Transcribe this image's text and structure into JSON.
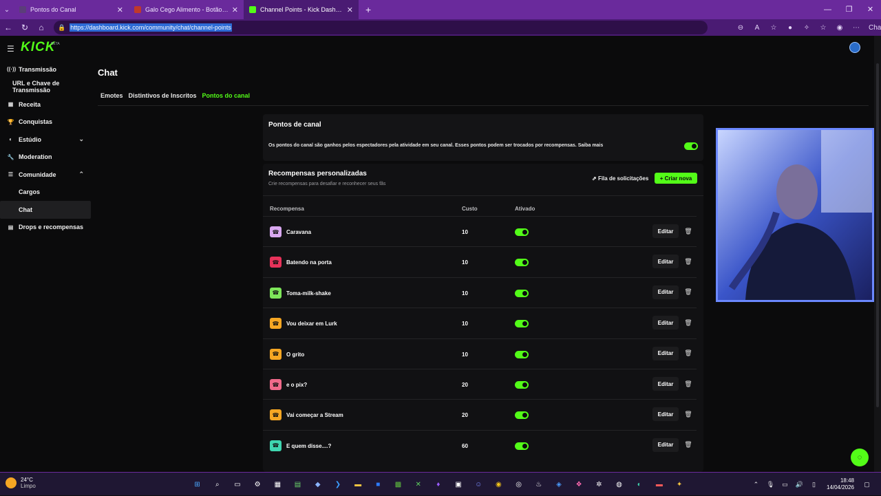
{
  "browser": {
    "tabs": [
      {
        "title": "Pontos do Canal",
        "icon_color": "#5b3d7a",
        "active": false
      },
      {
        "title": "Galo Cego Alimento - Botão de el...",
        "icon_color": "#c0392b",
        "active": false
      },
      {
        "title": "Channel Points - Kick Dashboard",
        "icon_color": "#53fc18",
        "active": true
      }
    ],
    "url": "https://dashboard.kick.com/community/chat/channel-points",
    "copilot_label": "Chat"
  },
  "app": {
    "logo": "KICK",
    "beta": "BETA",
    "accent": "#53fc18",
    "sidebar": [
      {
        "label": "Transmissão",
        "icon": "broadcast-icon",
        "glyph": "((·))",
        "level": 0
      },
      {
        "label": "URL e Chave de Transmissão",
        "level": 2
      },
      {
        "label": "Receita",
        "icon": "revenue-icon",
        "glyph": "▦",
        "level": 0
      },
      {
        "label": "Conquistas",
        "icon": "trophy-icon",
        "glyph": "🏆",
        "level": 0
      },
      {
        "label": "Estúdio",
        "icon": "studio-icon",
        "glyph": "◐",
        "level": 0,
        "chevron": "⌄"
      },
      {
        "label": "Moderation",
        "icon": "wrench-icon",
        "glyph": "🔧",
        "level": 0
      },
      {
        "label": "Comunidade",
        "icon": "community-icon",
        "glyph": "☰",
        "level": 0,
        "chevron": "⌃"
      },
      {
        "label": "Cargos",
        "level": 1
      },
      {
        "label": "Chat",
        "level": 1,
        "active": true
      },
      {
        "label": "Drops e recompensas",
        "icon": "drops-icon",
        "glyph": "▤",
        "level": 0
      }
    ],
    "page_title": "Chat",
    "subtabs": [
      {
        "label": "Emotes",
        "active": false
      },
      {
        "label": "Distintivos de Inscritos",
        "active": false
      },
      {
        "label": "Pontos do canal",
        "active": true
      }
    ],
    "channel_points": {
      "title": "Pontos de canal",
      "description": "Os pontos do canal são ganhos pelos espectadores pela atividade em seu canal. Esses pontos podem ser trocados por recompensas. Saiba mais",
      "enabled": true
    },
    "rewards": {
      "title": "Recompensas personalizadas",
      "subtitle": "Crie recompensas para desafiar e reconhecer seus fãs",
      "queue_label": "Fila de solicitações",
      "create_label": "Criar nova",
      "columns": {
        "reward": "Recompensa",
        "cost": "Custo",
        "enabled": "Ativado"
      },
      "edit_label": "Editar",
      "items": [
        {
          "name": "Caravana",
          "cost": "10",
          "color": "#d9a8f0"
        },
        {
          "name": "Batendo na porta",
          "cost": "10",
          "color": "#e8325a"
        },
        {
          "name": "Toma-milk-shake",
          "cost": "10",
          "color": "#7ee65a"
        },
        {
          "name": "Vou deixar em Lurk",
          "cost": "10",
          "color": "#f5a623"
        },
        {
          "name": "O grito",
          "cost": "10",
          "color": "#f5a623"
        },
        {
          "name": "e o pix?",
          "cost": "20",
          "color": "#f06a8a"
        },
        {
          "name": "Vai começar a Stream",
          "cost": "20",
          "color": "#f5a623"
        },
        {
          "name": "E quem disse....?",
          "cost": "60",
          "color": "#3fd6b0"
        }
      ]
    }
  },
  "taskbar": {
    "temperature": "24°C",
    "weather": "Limpo",
    "time": "18:48",
    "date": "14/04/2026"
  }
}
